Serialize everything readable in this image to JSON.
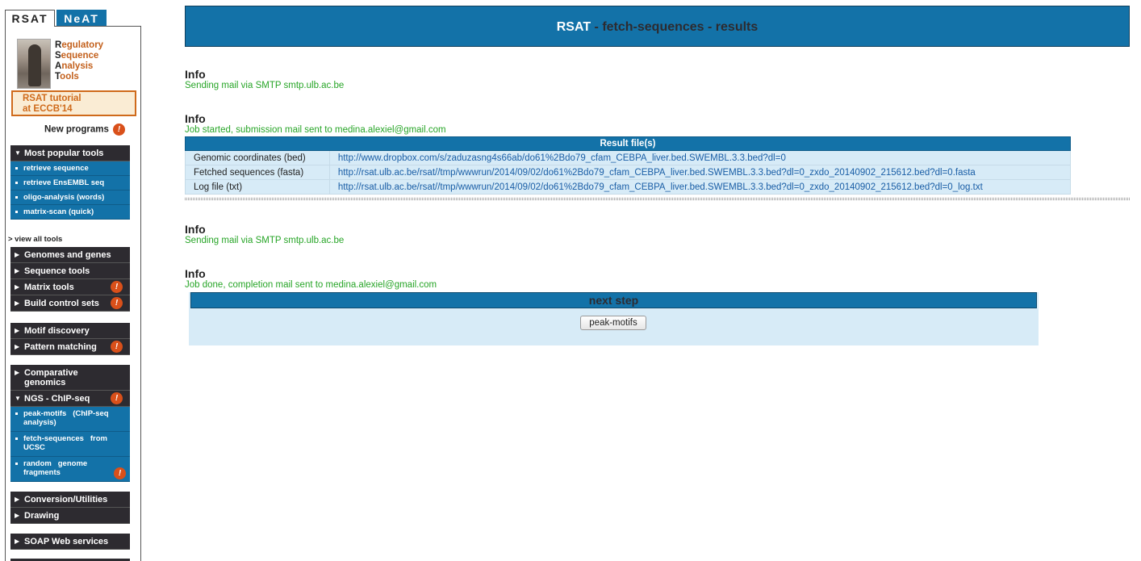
{
  "tabs": {
    "rsat": "RSAT",
    "neat": "NeAT"
  },
  "logo": {
    "lines": [
      {
        "init": "R",
        "rest": "egulatory"
      },
      {
        "init": "S",
        "rest": "equence"
      },
      {
        "init": "A",
        "rest": "nalysis"
      },
      {
        "init": "T",
        "rest": "ools"
      }
    ]
  },
  "tutorial": {
    "line1": "RSAT tutorial",
    "line2": "at ECCB'14"
  },
  "new_programs": {
    "label": "New programs",
    "badge": "!"
  },
  "sidebar": {
    "popular": {
      "head": "Most popular tools",
      "items": [
        "retrieve sequence",
        "retrieve EnsEMBL seq",
        "oligo-analysis (words)",
        "matrix-scan (quick)"
      ]
    },
    "view_all": "> view all tools",
    "group1": [
      "Genomes and genes",
      "Sequence tools",
      "Matrix tools",
      "Build control sets"
    ],
    "group2": [
      "Motif discovery",
      "Pattern matching"
    ],
    "group3": {
      "comparative_line1": "Comparative",
      "comparative_line2": "genomics",
      "ngs_head": "NGS - ChIP-seq",
      "ngs_items": [
        {
          "line1": "peak-motifs   (ChIP-seq",
          "line2": "analysis)"
        },
        {
          "line1": "fetch-sequences   from",
          "line2": "UCSC"
        },
        {
          "line1": "random   genome",
          "line2": "fragments"
        }
      ]
    },
    "group4": [
      "Conversion/Utilities",
      "Drawing"
    ],
    "group5": [
      "SOAP Web services"
    ]
  },
  "header": {
    "rsat": "RSAT",
    "rest": " - fetch-sequences - results"
  },
  "info_blocks": [
    {
      "title": "Info",
      "message": "Sending mail via SMTP smtp.ulb.ac.be"
    },
    {
      "title": "Info",
      "message": "Job started, submission mail sent to medina.alexiel@gmail.com"
    },
    {
      "title": "Info",
      "message": "Sending mail via SMTP smtp.ulb.ac.be"
    },
    {
      "title": "Info",
      "message": "Job done, completion mail sent to medina.alexiel@gmail.com"
    }
  ],
  "results": {
    "header": "Result file(s)",
    "rows": [
      {
        "label": "Genomic coordinates (bed)",
        "url": "http://www.dropbox.com/s/zaduzasng4s66ab/do61%2Bdo79_cfam_CEBPA_liver.bed.SWEMBL.3.3.bed?dl=0"
      },
      {
        "label": "Fetched sequences (fasta)",
        "url": "http://rsat.ulb.ac.be/rsat//tmp/wwwrun/2014/09/02/do61%2Bdo79_cfam_CEBPA_liver.bed.SWEMBL.3.3.bed?dl=0_zxdo_20140902_215612.bed?dl=0.fasta"
      },
      {
        "label": "Log file (txt)",
        "url": "http://rsat.ulb.ac.be/rsat//tmp/wwwrun/2014/09/02/do61%2Bdo79_cfam_CEBPA_liver.bed.SWEMBL.3.3.bed?dl=0_zxdo_20140902_215612.bed?dl=0_log.txt"
      }
    ]
  },
  "next_step": {
    "title": "next step",
    "button": "peak-motifs"
  },
  "colors": {
    "brand_blue": "#1372a8",
    "dark_menu": "#2d2b30",
    "accent_orange": "#cf6a1b",
    "info_green": "#27a527"
  }
}
